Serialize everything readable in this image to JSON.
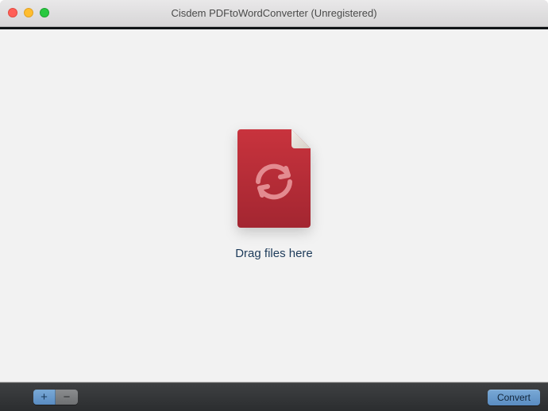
{
  "window": {
    "title": "Cisdem PDFtoWordConverter (Unregistered)"
  },
  "content": {
    "drag_label": "Drag files here"
  },
  "toolbar": {
    "add_label": "+",
    "remove_label": "−",
    "convert_label": "Convert"
  },
  "colors": {
    "file_red": "#b32a34",
    "file_red_light": "#c8333d",
    "accent_blue": "#6a9ccf"
  }
}
